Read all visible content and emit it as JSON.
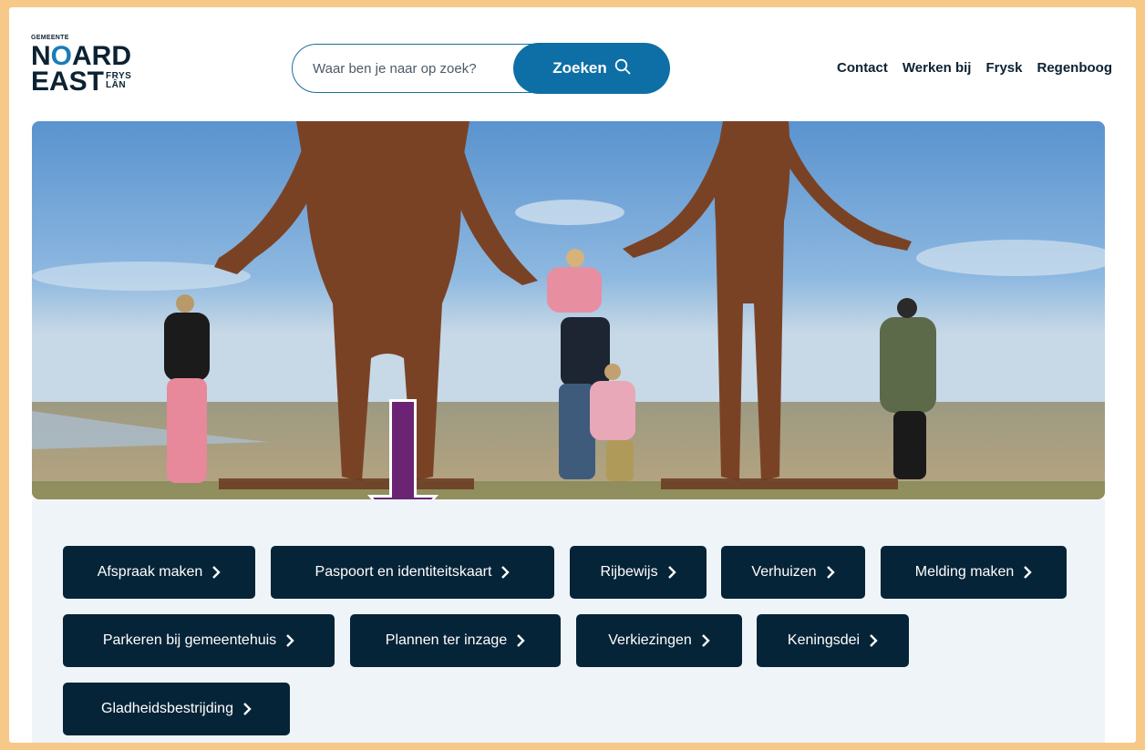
{
  "logo": {
    "gemeente": "GEMEENTE",
    "line1_n": "N",
    "line1_o": "O",
    "line1_rest": "ARD",
    "line2": "EAST",
    "frys": "FRYS",
    "lan": "LÂN"
  },
  "search": {
    "placeholder": "Waar ben je naar op zoek?",
    "button_label": "Zoeken",
    "icon": "search-icon"
  },
  "nav": {
    "items": [
      "Contact",
      "Werken bij",
      "Frysk",
      "Regenboog"
    ]
  },
  "hero": {
    "description_alt": "",
    "annotation_arrow_color": "#6b2474"
  },
  "tiles": {
    "items": [
      "Afspraak maken",
      "Paspoort en identiteitskaart",
      "Rijbewijs",
      "Verhuizen",
      "Melding maken",
      "Parkeren bij gemeentehuis",
      "Plannen ter inzage",
      "Verkiezingen",
      "Keningsdei",
      "Gladheidsbestrijding"
    ],
    "icon": "chevron-right-icon"
  },
  "colors": {
    "frame_border": "#f6c989",
    "brand_blue": "#0e6fa6",
    "tile_bg": "#062437",
    "panel_bg": "#eef4f7"
  }
}
